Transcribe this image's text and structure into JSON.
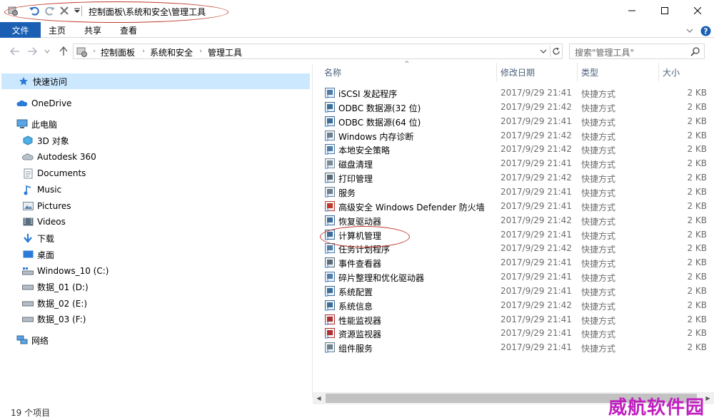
{
  "title_bar": {
    "path": "控制面板\\系统和安全\\管理工具"
  },
  "ribbon": {
    "file": "文件",
    "tabs": [
      "主页",
      "共享",
      "查看"
    ]
  },
  "address": {
    "crumbs": [
      "控制面板",
      "系统和安全",
      "管理工具"
    ],
    "search_placeholder": "搜索\"管理工具\""
  },
  "nav": {
    "quick_access": "快速访问",
    "onedrive": "OneDrive",
    "this_pc": "此电脑",
    "items": [
      {
        "label": "3D 对象",
        "icon": "3d-objects-icon"
      },
      {
        "label": "Autodesk 360",
        "icon": "cloud-icon"
      },
      {
        "label": "Documents",
        "icon": "documents-icon"
      },
      {
        "label": "Music",
        "icon": "music-icon"
      },
      {
        "label": "Pictures",
        "icon": "pictures-icon"
      },
      {
        "label": "Videos",
        "icon": "videos-icon"
      },
      {
        "label": "下载",
        "icon": "download-icon"
      },
      {
        "label": "桌面",
        "icon": "desktop-icon"
      },
      {
        "label": "Windows_10 (C:)",
        "icon": "system-drive-icon"
      },
      {
        "label": "数据_01 (D:)",
        "icon": "drive-icon"
      },
      {
        "label": "数据_02 (E:)",
        "icon": "drive-icon"
      },
      {
        "label": "数据_03 (F:)",
        "icon": "drive-icon"
      }
    ],
    "network": "网络"
  },
  "columns": {
    "name": "名称",
    "date": "修改日期",
    "type": "类型",
    "size": "大小"
  },
  "files": [
    {
      "name": "iSCSI 发起程序",
      "date": "2017/9/29 21:41",
      "type": "快捷方式",
      "size": "2 KB"
    },
    {
      "name": "ODBC 数据源(32 位)",
      "date": "2017/9/29 21:42",
      "type": "快捷方式",
      "size": "2 KB"
    },
    {
      "name": "ODBC 数据源(64 位)",
      "date": "2017/9/29 21:41",
      "type": "快捷方式",
      "size": "2 KB"
    },
    {
      "name": "Windows 内存诊断",
      "date": "2017/9/29 21:42",
      "type": "快捷方式",
      "size": "2 KB"
    },
    {
      "name": "本地安全策略",
      "date": "2017/9/29 21:42",
      "type": "快捷方式",
      "size": "2 KB"
    },
    {
      "name": "磁盘清理",
      "date": "2017/9/29 21:41",
      "type": "快捷方式",
      "size": "2 KB"
    },
    {
      "name": "打印管理",
      "date": "2017/9/29 21:42",
      "type": "快捷方式",
      "size": "2 KB"
    },
    {
      "name": "服务",
      "date": "2017/9/29 21:41",
      "type": "快捷方式",
      "size": "2 KB"
    },
    {
      "name": "高级安全 Windows Defender 防火墙",
      "date": "2017/9/29 21:41",
      "type": "快捷方式",
      "size": "2 KB"
    },
    {
      "name": "恢复驱动器",
      "date": "2017/9/29 21:42",
      "type": "快捷方式",
      "size": "2 KB"
    },
    {
      "name": "计算机管理",
      "date": "2017/9/29 21:41",
      "type": "快捷方式",
      "size": "2 KB"
    },
    {
      "name": "任务计划程序",
      "date": "2017/9/29 21:42",
      "type": "快捷方式",
      "size": "2 KB"
    },
    {
      "name": "事件查看器",
      "date": "2017/9/29 21:41",
      "type": "快捷方式",
      "size": "2 KB"
    },
    {
      "name": "碎片整理和优化驱动器",
      "date": "2017/9/29 21:41",
      "type": "快捷方式",
      "size": "2 KB"
    },
    {
      "name": "系统配置",
      "date": "2017/9/29 21:41",
      "type": "快捷方式",
      "size": "2 KB"
    },
    {
      "name": "系统信息",
      "date": "2017/9/29 21:42",
      "type": "快捷方式",
      "size": "2 KB"
    },
    {
      "name": "性能监视器",
      "date": "2017/9/29 21:41",
      "type": "快捷方式",
      "size": "2 KB"
    },
    {
      "name": "资源监视器",
      "date": "2017/9/29 21:41",
      "type": "快捷方式",
      "size": "2 KB"
    },
    {
      "name": "组件服务",
      "date": "2017/9/29 21:41",
      "type": "快捷方式",
      "size": "2 KB"
    }
  ],
  "status": {
    "count": "19 个项目"
  },
  "watermark": "威航软件园",
  "colors": {
    "accent": "#1a5fb4",
    "selection": "#cce8ff",
    "annotation": "#c0392b",
    "watermark": "#c01fc0"
  }
}
